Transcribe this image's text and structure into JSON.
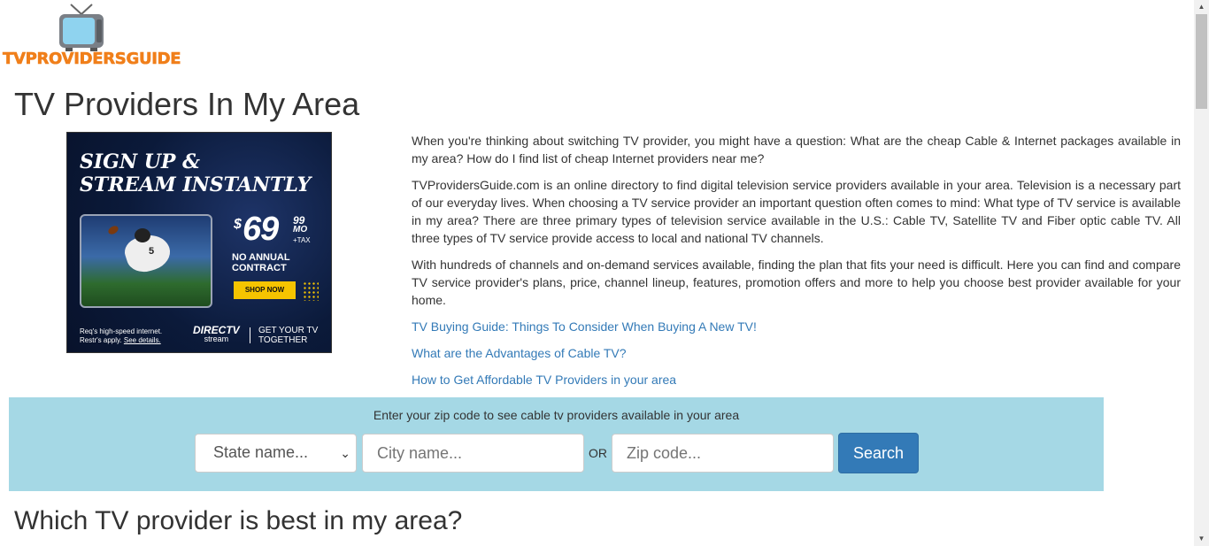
{
  "logo": {
    "text": "TVPROVIDERSGUIDE",
    "icon": "tv-icon"
  },
  "page_title": "TV Providers In My Area",
  "ad": {
    "headline_line1": "SIGN UP &",
    "headline_line2": "STREAM INSTANTLY",
    "price_dollar": "$",
    "price": "69",
    "price_cents": "99",
    "price_period": "MO",
    "price_tax": "+TAX",
    "contract_text": "NO ANNUAL CONTRACT",
    "cta": "SHOP NOW",
    "disclaimer_line1": "Req's high-speed internet.",
    "disclaimer_line2": "Restr's apply.",
    "disclaimer_link": "See details.",
    "brand": "DIRECTV",
    "brand_sub": "stream",
    "tagline": "GET YOUR TV TOGETHER",
    "jersey": "5"
  },
  "intro": {
    "p1": "When you're thinking about switching TV provider, you might have a question: What are the cheap Cable & Internet packages available in my area? How do I find list of cheap Internet providers near me?",
    "p2": "TVProvidersGuide.com is an online directory to find digital television service providers available in your area. Television is a necessary part of our everyday lives. When choosing a TV service provider an important question often comes to mind: What type of TV service is available in my area? There are three primary types of television service available in the U.S.: Cable TV, Satellite TV and Fiber optic cable TV. All three types of TV service provide access to local and national TV channels.",
    "p3": "With hundreds of channels and on-demand services available, finding the plan that fits your need is difficult. Here you can find and compare TV service provider's plans, price, channel lineup, features, promotion offers and more to help you choose best provider available for your home.",
    "links": [
      "TV Buying Guide: Things To Consider When Buying A New TV!",
      "What are the Advantages of Cable TV?",
      "How to Get Affordable TV Providers in your area"
    ]
  },
  "search": {
    "prompt": "Enter your zip code to see cable tv providers available in your area",
    "state_selected": "State name...",
    "city_placeholder": "City name...",
    "or_label": "OR",
    "zip_placeholder": "Zip code...",
    "button_label": "Search"
  },
  "section_title": "Which TV provider is best in my area?",
  "colors": {
    "logo_orange": "#f07f1a",
    "link_blue": "#337ab7",
    "search_band_bg": "#a5d8e5",
    "button_blue": "#337ab7"
  }
}
